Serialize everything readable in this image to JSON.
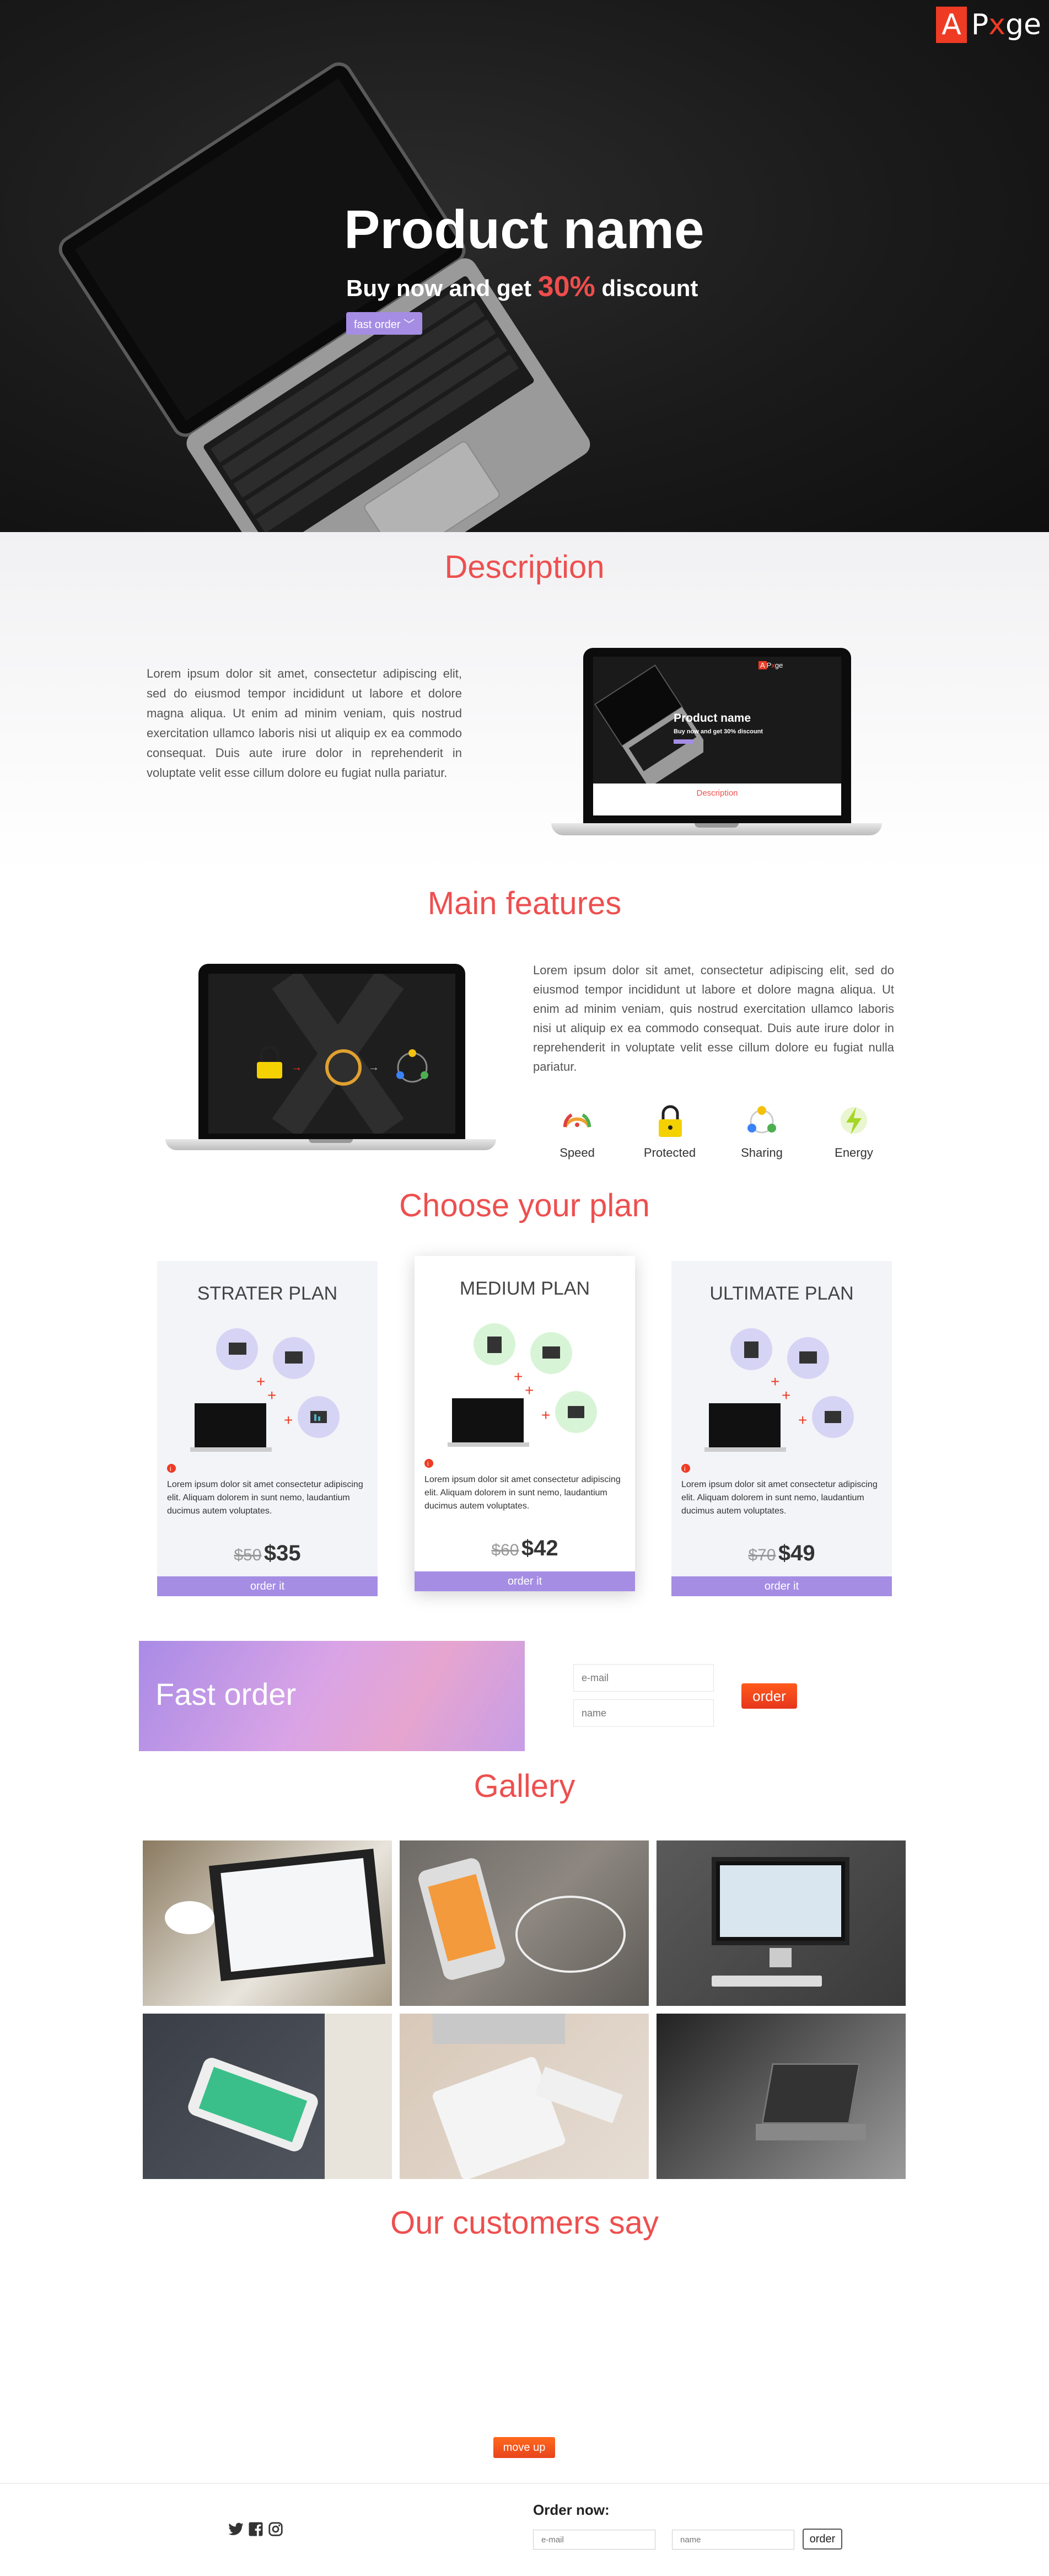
{
  "brand": {
    "a": "A",
    "p": "P",
    "x": "x",
    "ge": "ge"
  },
  "hero": {
    "title": "Product name",
    "sub_prefix": "Buy now and get",
    "sub_pct": "30%",
    "sub_suffix": "discount",
    "fast_order_label": "fast order ﹀"
  },
  "description": {
    "title": "Description",
    "text": "Lorem ipsum dolor sit amet, consectetur adipiscing elit, sed do eiusmod tempor incididunt ut labore et dolore magna aliqua. Ut enim ad minim veniam, quis nostrud exercitation ullamco laboris nisi ut aliquip ex ea commodo consequat. Duis aute irure dolor in reprehenderit in voluptate velit esse cillum dolore eu fugiat nulla pariatur.",
    "mini_title": "Product name",
    "mini_sub": "Buy now and get 30% discount",
    "mini_desc": "Description"
  },
  "features": {
    "title": "Main features",
    "text": "Lorem ipsum dolor sit amet, consectetur adipiscing elit, sed do eiusmod tempor incididunt ut labore et dolore magna aliqua. Ut enim ad minim veniam, quis nostrud exercitation ullamco laboris nisi ut aliquip ex ea commodo consequat. Duis aute irure dolor in reprehenderit in voluptate velit esse cillum dolore eu fugiat nulla pariatur.",
    "items": [
      {
        "label": "Speed",
        "icon": "speedometer-icon"
      },
      {
        "label": "Protected",
        "icon": "padlock-icon"
      },
      {
        "label": "Sharing",
        "icon": "sharing-icon"
      },
      {
        "label": "Energy",
        "icon": "lightning-icon"
      }
    ]
  },
  "plans": {
    "title": "Choose your plan",
    "items": [
      {
        "name": "STRATER PLAN",
        "text": "Lorem ipsum dolor sit amet consectetur adipiscing elit. Aliquam dolorem in sunt nemo, laudantium ducimus autem voluptates.",
        "old": "$50",
        "new": "$35",
        "order": "order it"
      },
      {
        "name": "MEDIUM PLAN",
        "text": "Lorem ipsum dolor sit amet consectetur adipiscing elit. Aliquam dolorem in sunt nemo, laudantium ducimus autem voluptates.",
        "old": "$60",
        "new": "$42",
        "order": "order it"
      },
      {
        "name": "ULTIMATE PLAN",
        "text": "Lorem ipsum dolor sit amet consectetur adipiscing elit. Aliquam dolorem in sunt nemo, laudantium ducimus autem voluptates.",
        "old": "$70",
        "new": "$49",
        "order": "order it"
      }
    ]
  },
  "fast_order": {
    "title": "Fast order",
    "email_placeholder": "e-mail",
    "name_placeholder": "name",
    "button": "order"
  },
  "gallery": {
    "title": "Gallery"
  },
  "testimonials": {
    "title": "Our customers say"
  },
  "footer": {
    "move_up": "move up",
    "order_now": "Order now:",
    "email_placeholder": "e-mail",
    "name_placeholder": "name",
    "order_button": "order"
  },
  "colors": {
    "accent": "#ee4f4f",
    "purple": "#a58de4",
    "orange": "#f2561d"
  }
}
